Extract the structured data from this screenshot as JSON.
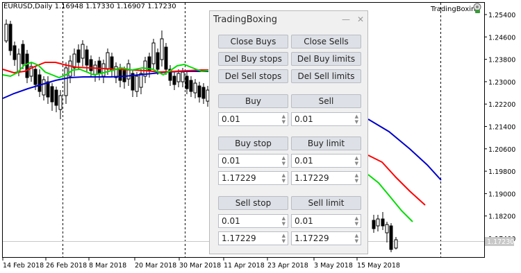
{
  "chart": {
    "symbol_info": "EURUSD,Daily  1.16948 1.17330 1.16907 1.17230",
    "indicator_label": "TradingBoxing",
    "current_price": "1.17230",
    "price_ticks": [
      "1.25400",
      "1.24600",
      "1.23800",
      "1.23000",
      "1.22200",
      "1.21400",
      "1.20600",
      "1.19800",
      "1.19000",
      "1.18200",
      "1.17400"
    ],
    "date_ticks": [
      "14 Feb 2018",
      "26 Feb 2018",
      "8 Mar 2018",
      "20 Mar 2018",
      "30 Mar 2018",
      "11 Apr 2018",
      "23 Apr 2018",
      "3 May 2018",
      "15 May 2018"
    ],
    "colors": {
      "red_line": "#ff0000",
      "blue_line": "#0000cc",
      "green_line": "#00e000",
      "current_price_bg": "#c8c8c8"
    }
  },
  "panel": {
    "title": "TradingBoxing",
    "minimize_icon": "minimize-icon",
    "close_icon": "close-icon",
    "close_buys": "Close Buys",
    "close_sells": "Close Sells",
    "del_buy_stops": "Del Buy stops",
    "del_buy_limits": "Del Buy limits",
    "del_sell_stops": "Del Sell stops",
    "del_sell_limits": "Del Sell limits",
    "buy": "Buy",
    "sell": "Sell",
    "buy_lot": "0.01",
    "sell_lot": "0.01",
    "buy_stop": "Buy stop",
    "buy_limit": "Buy limit",
    "buy_stop_lot": "0.01",
    "buy_limit_lot": "0.01",
    "buy_stop_price": "1.17229",
    "buy_limit_price": "1.17229",
    "sell_stop": "Sell stop",
    "sell_limit": "Sell limit",
    "sell_stop_lot": "0.01",
    "sell_limit_lot": "0.01",
    "sell_stop_price": "1.17229",
    "sell_limit_price": "1.17229"
  }
}
